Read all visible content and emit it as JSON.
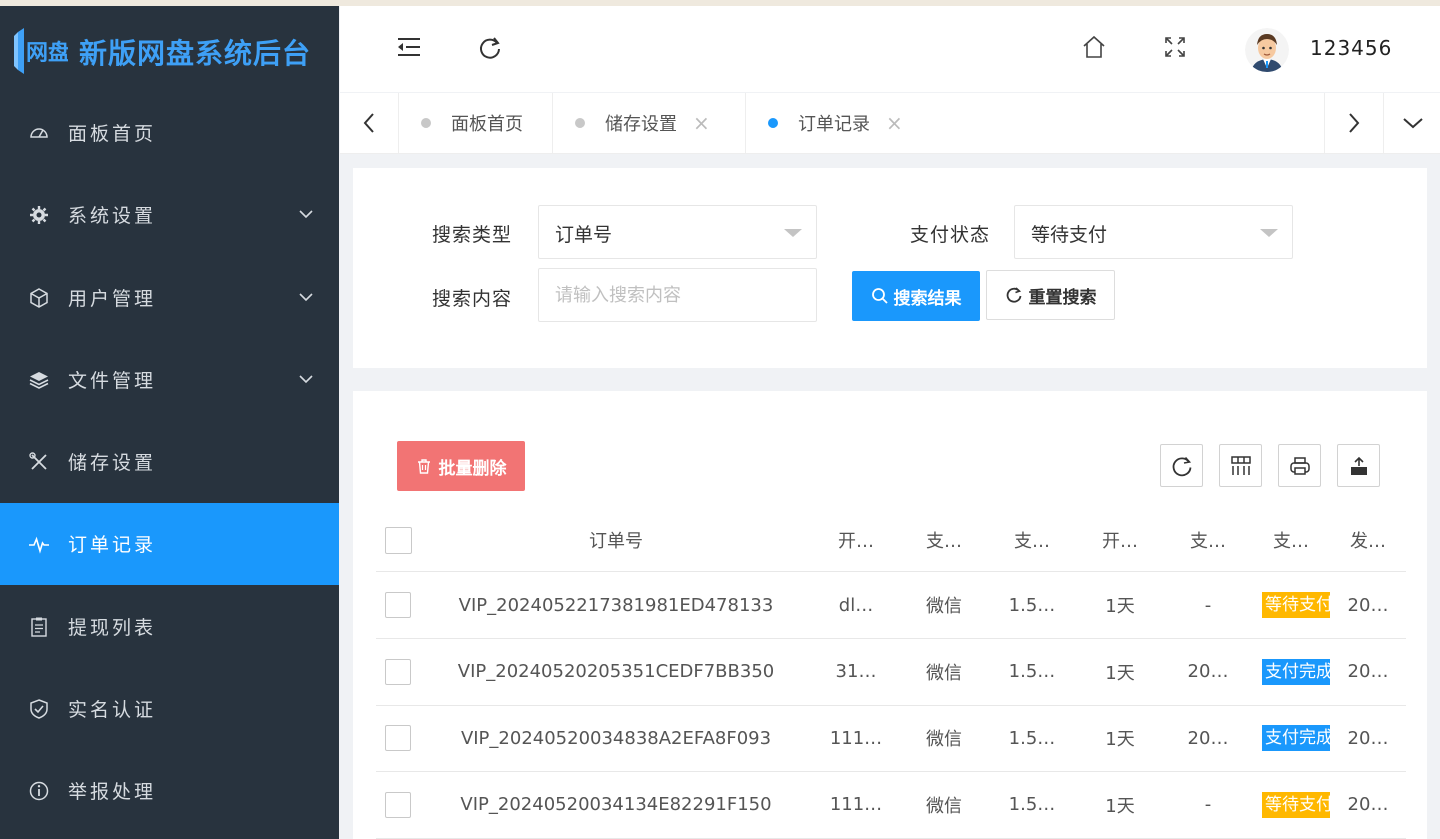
{
  "app": {
    "title": "新版网盘系统后台"
  },
  "sidebar": {
    "items": [
      {
        "label": "面板首页",
        "icon": "dashboard-icon",
        "has_children": false,
        "active": false
      },
      {
        "label": "系统设置",
        "icon": "gear-icon",
        "has_children": true,
        "active": false
      },
      {
        "label": "用户管理",
        "icon": "cube-icon",
        "has_children": true,
        "active": false
      },
      {
        "label": "文件管理",
        "icon": "layers-icon",
        "has_children": true,
        "active": false
      },
      {
        "label": "储存设置",
        "icon": "tools-icon",
        "has_children": false,
        "active": false
      },
      {
        "label": "订单记录",
        "icon": "pulse-icon",
        "has_children": false,
        "active": true
      },
      {
        "label": "提现列表",
        "icon": "clipboard-icon",
        "has_children": false,
        "active": false
      },
      {
        "label": "实名认证",
        "icon": "shield-check-icon",
        "has_children": false,
        "active": false
      },
      {
        "label": "举报处理",
        "icon": "info-icon",
        "has_children": false,
        "active": false
      }
    ]
  },
  "header": {
    "username": "123456",
    "icons": [
      "menu-fold-icon",
      "refresh-icon",
      "home-icon",
      "fullscreen-icon",
      "avatar"
    ]
  },
  "tabs": {
    "items": [
      {
        "label": "面板首页",
        "closable": false,
        "active": false
      },
      {
        "label": "储存设置",
        "closable": true,
        "active": false
      },
      {
        "label": "订单记录",
        "closable": true,
        "active": true
      }
    ],
    "close_glyph": "×"
  },
  "search": {
    "type_label": "搜索类型",
    "type_value": "订单号",
    "status_label": "支付状态",
    "status_value": "等待支付",
    "content_label": "搜索内容",
    "content_placeholder": "请输入搜索内容",
    "content_value": "",
    "search_button": "搜索结果",
    "reset_button": "重置搜索"
  },
  "table": {
    "batch_delete": "批量删除",
    "columns": [
      "订单号",
      "开…",
      "支…",
      "支…",
      "开…",
      "支…",
      "支…",
      "发…"
    ],
    "rows": [
      {
        "order_no": "VIP_2024052217381981ED478133",
        "c2": "dl…",
        "c3": "微信",
        "c4": "1.5…",
        "c5": "1天",
        "c6": "-",
        "status": "等待支付",
        "status_type": "wait",
        "c8": "20…"
      },
      {
        "order_no": "VIP_20240520205351CEDF7BB350",
        "c2": "31…",
        "c3": "微信",
        "c4": "1.5…",
        "c5": "1天",
        "c6": "20…",
        "status": "支付完成",
        "status_type": "done",
        "c8": "20…"
      },
      {
        "order_no": "VIP_20240520034838A2EFA8F093",
        "c2": "111…",
        "c3": "微信",
        "c4": "1.5…",
        "c5": "1天",
        "c6": "20…",
        "status": "支付完成",
        "status_type": "done",
        "c8": "20…"
      },
      {
        "order_no": "VIP_20240520034134E82291F150",
        "c2": "111…",
        "c3": "微信",
        "c4": "1.5…",
        "c5": "1天",
        "c6": "-",
        "status": "等待支付",
        "status_type": "wait",
        "c8": "20…"
      }
    ]
  },
  "colors": {
    "sidebar_bg": "#28333e",
    "accent": "#1a98fc",
    "danger": "#f27474",
    "warning": "#ffb800"
  }
}
